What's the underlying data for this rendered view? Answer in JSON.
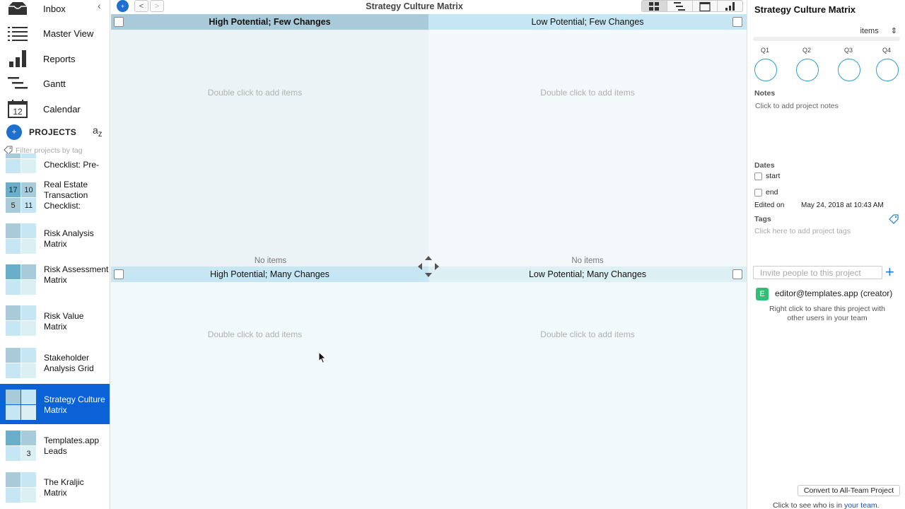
{
  "sidebar": {
    "nav": [
      {
        "label": "Inbox",
        "icon": "inbox-icon"
      },
      {
        "label": "Master View",
        "icon": "list-icon"
      },
      {
        "label": "Reports",
        "icon": "bar-chart-icon"
      },
      {
        "label": "Gantt",
        "icon": "gantt-icon"
      },
      {
        "label": "Calendar",
        "icon": "calendar-icon",
        "day": "12"
      }
    ],
    "projects_title": "PROJECTS",
    "sort_label": "a z",
    "filter_placeholder": "Filter projects by tag",
    "projects": [
      {
        "name": "Checklist: Pre-"
      },
      {
        "name": "Real Estate Transaction Checklist:",
        "counts": [
          "17",
          "10",
          "5",
          "11"
        ]
      },
      {
        "name": "Risk Analysis Matrix"
      },
      {
        "name": "Risk Assessment Matrix"
      },
      {
        "name": "Risk Value Matrix"
      },
      {
        "name": "Stakeholder Analysis Grid"
      },
      {
        "name": "Strategy Culture Matrix",
        "selected": true
      },
      {
        "name": "Templates.app Leads",
        "counts": [
          "",
          "",
          "",
          "3"
        ]
      },
      {
        "name": "The Kraljic Matrix"
      }
    ]
  },
  "toolbar": {
    "title": "Strategy Culture Matrix",
    "back": "<",
    "forward": ">",
    "add": "+"
  },
  "matrix": {
    "q1": {
      "title": "High Potential; Few Changes",
      "hint": "Double click to add items",
      "empty": "No items"
    },
    "q2": {
      "title": "Low Potential; Few Changes",
      "hint": "Double click to add items",
      "empty": "No items"
    },
    "q3": {
      "title": "High Potential; Many Changes",
      "hint": "Double click to add items"
    },
    "q4": {
      "title": "Low Potential; Many Changes",
      "hint": "Double click to add items"
    },
    "colors": {
      "q1_header": "#a9cad8",
      "q1_body": "#ecf3f6",
      "q2_header": "#c5e6f2",
      "q2_body": "#f3f9fb",
      "q3_header": "#c5e6f2",
      "q3_body": "#f2f9fb",
      "q4_header": "#dceff3",
      "q4_body": "#f2f9fb"
    }
  },
  "panel": {
    "title": "Strategy Culture Matrix",
    "items_select": "items",
    "quadrants": [
      "Q1",
      "Q2",
      "Q3",
      "Q4"
    ],
    "notes_label": "Notes",
    "notes_hint": "Click to add project notes",
    "dates_label": "Dates",
    "start_label": "start",
    "end_label": "end",
    "edited_label": "Edited on",
    "edited_value": "May 24, 2018 at 10:43 AM",
    "tags_label": "Tags",
    "tags_hint": "Click here to add project tags",
    "invite_placeholder": "Invite people to this project",
    "member_initial": "E",
    "member": "editor@templates.app (creator)",
    "share_hint": "Right click to share this project with other users in your team",
    "convert_button": "Convert to All-Team Project",
    "team_text": "Click to see who is in",
    "team_link": "your team."
  }
}
